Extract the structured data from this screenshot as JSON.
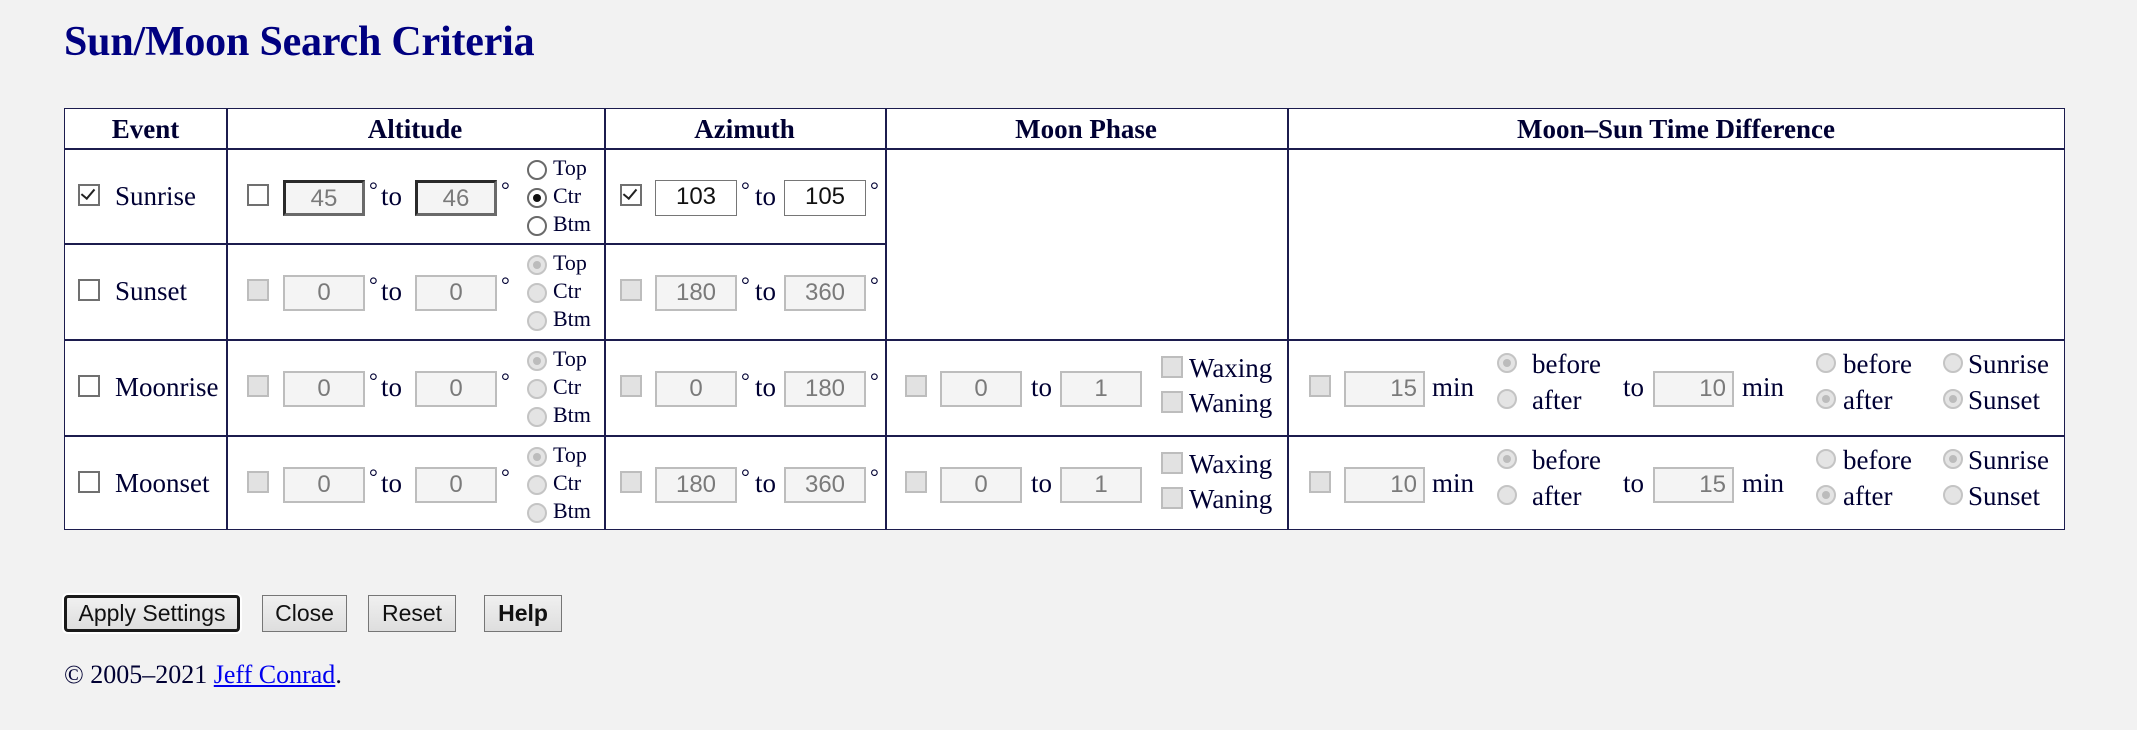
{
  "page": {
    "title": "Sun/Moon Search Criteria"
  },
  "table": {
    "headers": {
      "event": "Event",
      "altitude": "Altitude",
      "azimuth": "Azimuth",
      "moon_phase": "Moon Phase",
      "time_difference": "Moon–Sun Time Difference"
    },
    "common": {
      "to": "to",
      "degree": "°",
      "min": "min",
      "top": "Top",
      "ctr": "Ctr",
      "btm": "Btm",
      "waxing": "Waxing",
      "waning": "Waning",
      "before": "before",
      "after": "after",
      "sunrise": "Sunrise",
      "sunset": "Sunset"
    },
    "rows": [
      {
        "event": "Sunrise",
        "event_checked": true,
        "altitude": {
          "enabled_checked": false,
          "from": "45",
          "to": "46",
          "limb": "Ctr",
          "disabled": false
        },
        "azimuth": {
          "enabled_checked": true,
          "from": "103",
          "to": "105",
          "disabled": false
        }
      },
      {
        "event": "Sunset",
        "event_checked": false,
        "altitude": {
          "enabled_checked": false,
          "from": "0",
          "to": "0",
          "limb": "Top",
          "disabled": true
        },
        "azimuth": {
          "enabled_checked": false,
          "from": "180",
          "to": "360",
          "disabled": true
        }
      },
      {
        "event": "Moonrise",
        "event_checked": false,
        "altitude": {
          "enabled_checked": false,
          "from": "0",
          "to": "0",
          "limb": "Top",
          "disabled": true
        },
        "azimuth": {
          "enabled_checked": false,
          "from": "0",
          "to": "180",
          "disabled": true
        },
        "moon_phase": {
          "enabled_checked": false,
          "from": "0",
          "to": "1",
          "waxing": false,
          "waning": false,
          "disabled": true
        },
        "time_difference": {
          "enabled_checked": false,
          "from": "15",
          "from_rel": "before",
          "to": "10",
          "to_rel": "after",
          "sun_event": "Sunset",
          "disabled": true
        }
      },
      {
        "event": "Moonset",
        "event_checked": false,
        "altitude": {
          "enabled_checked": false,
          "from": "0",
          "to": "0",
          "limb": "Top",
          "disabled": true
        },
        "azimuth": {
          "enabled_checked": false,
          "from": "180",
          "to": "360",
          "disabled": true
        },
        "moon_phase": {
          "enabled_checked": false,
          "from": "0",
          "to": "1",
          "waxing": false,
          "waning": false,
          "disabled": true
        },
        "time_difference": {
          "enabled_checked": false,
          "from": "10",
          "from_rel": "before",
          "to": "15",
          "to_rel": "after",
          "sun_event": "Sunrise",
          "disabled": true
        }
      }
    ]
  },
  "buttons": {
    "apply": "Apply Settings",
    "close": "Close",
    "reset": "Reset",
    "help": "Help"
  },
  "footer": {
    "copyright": "© 2005–2021 ",
    "author_link": "Jeff Conrad",
    "period": "."
  },
  "colors": {
    "title": "#000080",
    "text": "#000033",
    "border": "#1c1c4e",
    "link": "#0000ee",
    "background": "#f2f2f2"
  }
}
